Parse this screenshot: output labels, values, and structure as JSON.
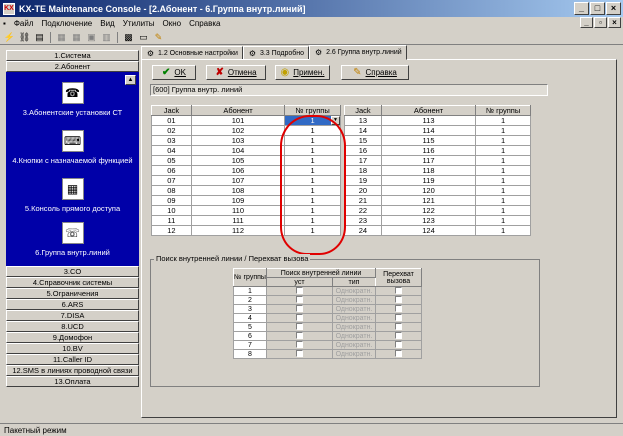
{
  "window": {
    "title": "KX-TE Maintenance Console - [2.Абонент - 6.Группа внутр.линий]",
    "app_icon": "KX"
  },
  "menu": [
    "Файл",
    "Подключение",
    "Вид",
    "Утилиты",
    "Окно",
    "Справка"
  ],
  "sidebar": {
    "top_items": [
      "1.Система",
      "2.Абонент"
    ],
    "sub_items": [
      "3.Абонентские установки СТ",
      "4.Кнопки с назначаемой функцией",
      "5.Консоль прямого доступа",
      "6.Группа внутр.линий"
    ],
    "bottom_items": [
      "3.CO",
      "4.Справочник системы",
      "5.Ограничения",
      "6.ARS",
      "7.DISA",
      "8.UCD",
      "9.Домофон",
      "10.BV",
      "11.Caller ID",
      "12.SMS в линиях проводной связи",
      "13.Оплата"
    ]
  },
  "tabs": [
    "1.2 Основные настройки",
    "3.3 Подробно",
    "2.6 Группа внутр.линий"
  ],
  "actions": {
    "ok": "OK",
    "cancel": "Отмена",
    "apply": "Примен.",
    "help": "Справка"
  },
  "section_label": "[600] Группа внутр. линий",
  "table": {
    "headers": [
      "Jack",
      "Абонент",
      "№ группы"
    ],
    "left": [
      [
        "01",
        "101",
        "1"
      ],
      [
        "02",
        "102",
        "1"
      ],
      [
        "03",
        "103",
        "1"
      ],
      [
        "04",
        "104",
        "1"
      ],
      [
        "05",
        "105",
        "1"
      ],
      [
        "06",
        "106",
        "1"
      ],
      [
        "07",
        "107",
        "1"
      ],
      [
        "08",
        "108",
        "1"
      ],
      [
        "09",
        "109",
        "1"
      ],
      [
        "10",
        "110",
        "1"
      ],
      [
        "11",
        "111",
        "1"
      ],
      [
        "12",
        "112",
        "1"
      ]
    ],
    "right": [
      [
        "13",
        "113",
        "1"
      ],
      [
        "14",
        "114",
        "1"
      ],
      [
        "15",
        "115",
        "1"
      ],
      [
        "16",
        "116",
        "1"
      ],
      [
        "17",
        "117",
        "1"
      ],
      [
        "18",
        "118",
        "1"
      ],
      [
        "19",
        "119",
        "1"
      ],
      [
        "20",
        "120",
        "1"
      ],
      [
        "21",
        "121",
        "1"
      ],
      [
        "22",
        "122",
        "1"
      ],
      [
        "23",
        "123",
        "1"
      ],
      [
        "24",
        "124",
        "1"
      ]
    ]
  },
  "search": {
    "title": "Поиск внутренней линии / Перехват вызова",
    "h_group": "№ группы",
    "h_search": "Поиск внутренней линии",
    "h_pickup": "Перехват вызова",
    "h_set": "уст",
    "h_type": "тип",
    "type_value": "Однократн.",
    "rows": [
      "1",
      "2",
      "3",
      "4",
      "5",
      "6",
      "7",
      "8"
    ]
  },
  "status": "Пакетный режим",
  "colors": {
    "title_from": "#0a246a",
    "title_to": "#a6caf0",
    "sidebar_blue": "#0000a8",
    "selected": "#316ac5",
    "annotation": "#e00000"
  }
}
